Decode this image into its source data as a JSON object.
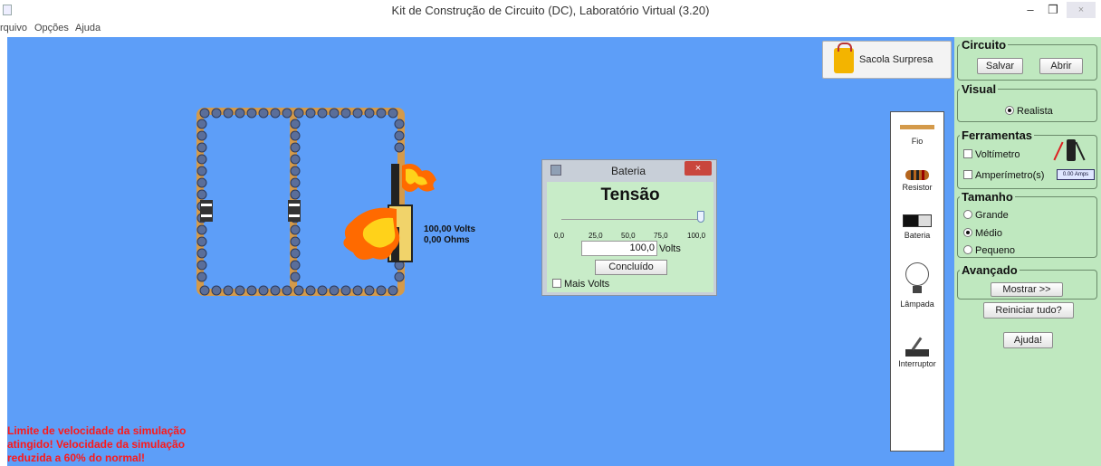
{
  "window": {
    "title": "Kit de Construção de Circuito (DC), Laboratório Virtual (3.20)",
    "min_glyph": "–",
    "max_glyph": "❐",
    "close_glyph": "×"
  },
  "menu": {
    "items": [
      "rquivo",
      "Opções",
      "Ajuda"
    ]
  },
  "sacola": {
    "label": "Sacola Surpresa"
  },
  "circuit": {
    "volts_label": "100,00 Volts",
    "ohms_label": "0,00 Ohms"
  },
  "dialog": {
    "title": "Bateria",
    "close_glyph": "×",
    "heading": "Tensão",
    "ticks": [
      "0,0",
      "25,0",
      "50,0",
      "75,0",
      "100,0"
    ],
    "value": "100,0",
    "unit": "Volts",
    "done_label": "Concluído",
    "more_volts_label": "Mais Volts",
    "slider_fraction": 1.0
  },
  "toolbox": {
    "items": [
      "Fio",
      "Resistor",
      "Bateria",
      "Lâmpada",
      "Interruptor"
    ]
  },
  "panel": {
    "circuito": {
      "title": "Circuito",
      "save": "Salvar",
      "open": "Abrir"
    },
    "visual": {
      "title": "Visual",
      "realista": "Realista"
    },
    "ferramentas": {
      "title": "Ferramentas",
      "voltimetro": "Voltímetro",
      "amperimetro": "Amperímetro(s)",
      "amp_readout": "0.00 Amps"
    },
    "tamanho": {
      "title": "Tamanho",
      "grande": "Grande",
      "medio": "Médio",
      "pequeno": "Pequeno"
    },
    "avancado": {
      "title": "Avançado",
      "show": "Mostrar >>"
    },
    "reset": "Reiniciar tudo?",
    "help": "Ajuda!"
  },
  "warning": "Limite de velocidade da simulação atingido! Velocidade da simulação reduzida a  60% do normal!",
  "colors": {
    "canvas": "#5d9ef8",
    "panel": "#bfe8bf",
    "warning": "#ff1818",
    "wire": "#d49a4a"
  }
}
